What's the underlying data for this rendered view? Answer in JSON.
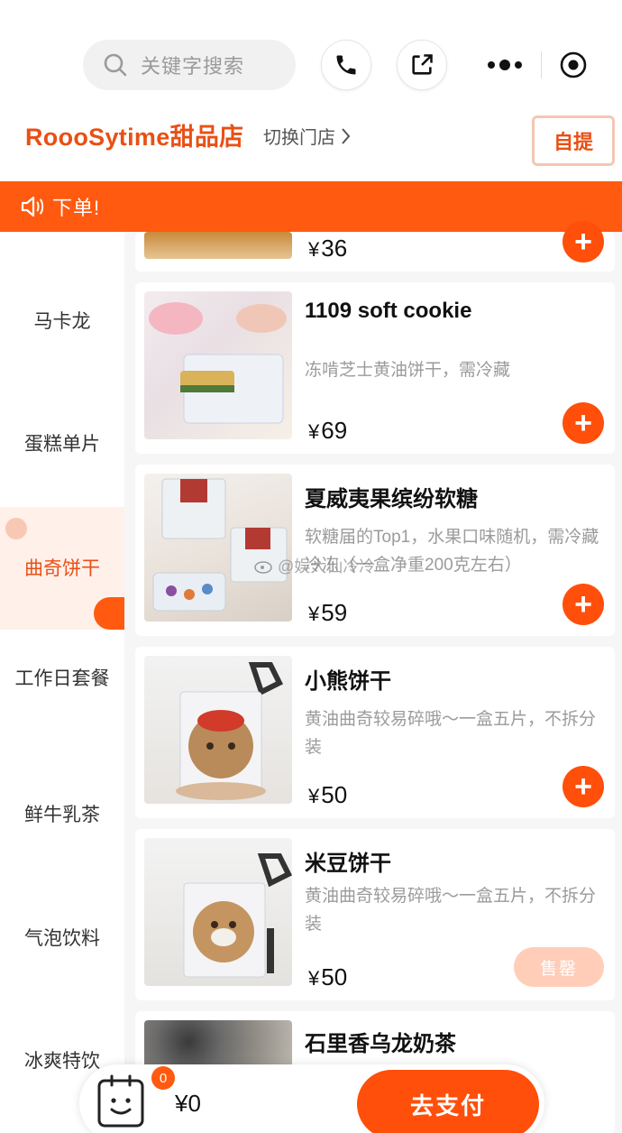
{
  "search": {
    "placeholder": "关键字搜索"
  },
  "header_icons": [
    "search-icon",
    "phone-icon",
    "share-icon",
    "more-icon",
    "target-icon"
  ],
  "store": {
    "name": "RoooSytime甜品店",
    "switch_label": "切换门店",
    "pickup_label": "自提"
  },
  "notice": {
    "text": "下单!"
  },
  "sidebar": {
    "items": [
      {
        "label": "马卡龙"
      },
      {
        "label": "蛋糕单片"
      },
      {
        "label": "曲奇饼干",
        "active": true
      },
      {
        "label": "工作日套餐"
      },
      {
        "label": "鲜牛乳茶"
      },
      {
        "label": "气泡饮料"
      },
      {
        "label": "冰爽特饮"
      }
    ]
  },
  "products": [
    {
      "name": "",
      "desc": "",
      "price": "36",
      "action": "add"
    },
    {
      "name": "1109 soft cookie",
      "desc": "冻啃芝士黄油饼干，需冷藏",
      "price": "69",
      "action": "add"
    },
    {
      "name": "夏威夷果缤纷软糖",
      "desc": "软糖届的Top1，水果口味随机，需冷藏冷冻（一盒净重200克左右）",
      "price": "59",
      "action": "add"
    },
    {
      "name": "小熊饼干",
      "desc": "黄油曲奇较易碎哦～一盒五片，不拆分装",
      "price": "50",
      "action": "add"
    },
    {
      "name": "米豆饼干",
      "desc": "黄油曲奇较易碎哦～一盒五片，不拆分装",
      "price": "50",
      "action": "soldout",
      "soldout_label": "售罄"
    },
    {
      "name": "石里香乌龙奶茶",
      "desc": "",
      "price": "",
      "action": ""
    }
  ],
  "currency": "¥",
  "watermark": {
    "text": "@娱大仙冷冷"
  },
  "cart": {
    "badge": "0",
    "total": "¥0",
    "pay_label": "去支付"
  },
  "colors": {
    "accent": "#ff5a0f",
    "brand_text": "#ea4f14",
    "sidebar_active_bg": "#fff0ea"
  }
}
